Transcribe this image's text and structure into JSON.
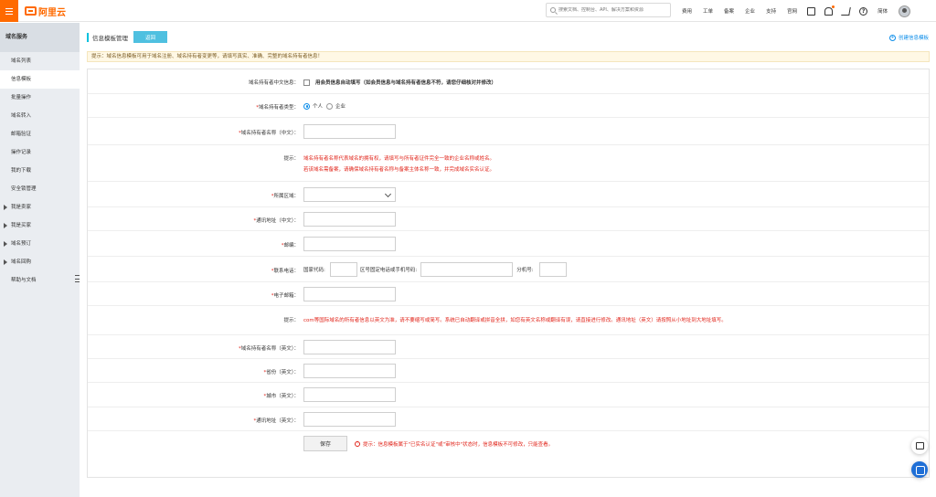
{
  "topbar": {
    "logo_text": "阿里云",
    "search_placeholder": "搜索文档、控制台、API、解决方案和资源",
    "nav": [
      "费用",
      "工单",
      "备案",
      "企业",
      "支持",
      "官网"
    ],
    "language": "简体",
    "brand_color": "#ff6a00"
  },
  "sidebar": {
    "title": "域名服务",
    "items": [
      {
        "label": "域名列表"
      },
      {
        "label": "信息模板"
      },
      {
        "label": "批量操作"
      },
      {
        "label": "域名转入"
      },
      {
        "label": "邮箱验证"
      },
      {
        "label": "操作记录"
      },
      {
        "label": "我的下载"
      },
      {
        "label": "安全锁管理"
      },
      {
        "label": "我是卖家"
      },
      {
        "label": "我是买家"
      },
      {
        "label": "域名预订"
      },
      {
        "label": "域名回购"
      },
      {
        "label": "帮助与文档"
      }
    ]
  },
  "header": {
    "title": "信息模板管理",
    "back_label": "返回",
    "create_link": "创建信息模板"
  },
  "notice": "提示：域名信息模板可用于域名注册、域名持有者变更等，请填写真实、准确、完整的域名持有者信息！",
  "form": {
    "owner_cn_info": {
      "label": "域名持有者中文信息：",
      "checkbox_text": "用会员信息自动填写（如会员信息与域名持有者信息不符，请您仔细核对并修改）"
    },
    "owner_type": {
      "label": "域名持有者类型：",
      "options": [
        "个人",
        "企业"
      ],
      "selected": "个人"
    },
    "owner_name_cn": {
      "label": "域名持有者名称（中文）："
    },
    "tip1": {
      "label": "提示：",
      "line1": "域名持有者名称代表域名的拥有权，请填写与所有者证件完全一致的企业名称或姓名。",
      "line2": "若该域名需备案，请确保域名持有者名称与备案主体名称一致，并完成域名实名认证。"
    },
    "region": {
      "label": "所属区域：",
      "value": ""
    },
    "address_cn": {
      "label": "通讯地址（中文）："
    },
    "postcode": {
      "label": "邮编："
    },
    "phone": {
      "label": "联系电话：",
      "country_code": "国家代码:",
      "area_phone": "区号固定电话或手机号码:",
      "extension": "分机号:"
    },
    "email": {
      "label": "电子邮箱："
    },
    "tip2": {
      "label": "提示：",
      "text": "com等国际域名的所有者信息以英文为准，请不要缩写或简写。系统已自动翻译或拼音全拼，如您有英文名称或翻译有误，请直接进行修改。通讯地址（英文）请按照从小地址到大地址填写。"
    },
    "owner_name_en": {
      "label": "域名持有者名称（英文）："
    },
    "province_en": {
      "label": "省份（英文）："
    },
    "city_en": {
      "label": "城市（英文）："
    },
    "address_en": {
      "label": "通讯地址（英文）："
    },
    "save_label": "保存",
    "save_tip": "提示：信息模板属于\"已实名认证\"或\"审核中\"状态时，信息模板不可修改，只能查看。"
  }
}
